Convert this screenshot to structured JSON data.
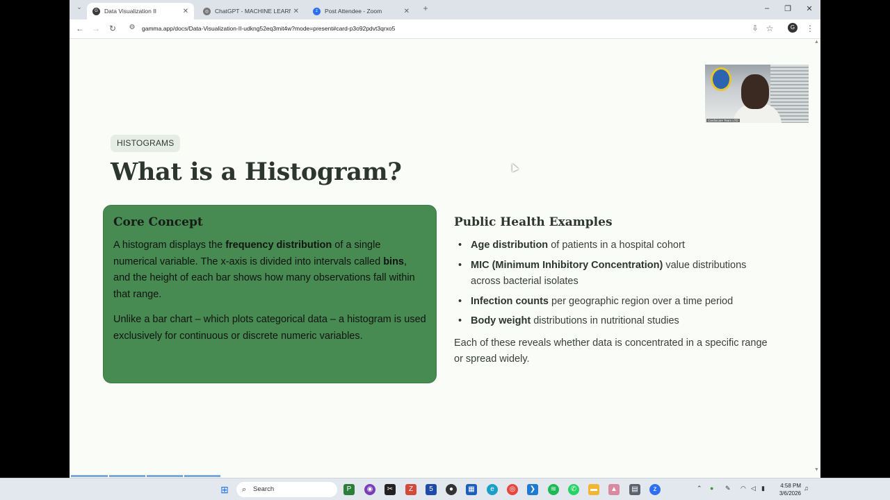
{
  "browser": {
    "tabs": [
      {
        "title": "Data Visualization II",
        "active": true
      },
      {
        "title": "ChatGPT - MACHINE LEARNING",
        "active": false
      },
      {
        "title": "Post Attendee - Zoom",
        "active": false
      }
    ],
    "url": "gamma.app/docs/Data-Visualization-II-udkng52eq3mit4w?mode=present#card-p3o92pdvt3qrxo5"
  },
  "slide": {
    "badge": "HISTOGRAMS",
    "title": "What is a Histogram?",
    "core": {
      "heading": "Core Concept",
      "p1_a": "A histogram displays the ",
      "p1_b": "frequency distribution",
      "p1_c": " of a single numerical variable. The x-axis is divided into intervals called ",
      "p1_d": "bins",
      "p1_e": ", and the height of each bar shows how many observations fall within that range.",
      "p2": "Unlike a bar chart – which plots categorical data – a histogram is used exclusively for continuous or discrete numeric variables."
    },
    "examples": {
      "heading": "Public Health Examples",
      "items": [
        {
          "bold": "Age distribution",
          "rest": " of patients in a hospital cohort"
        },
        {
          "bold": "MIC (Minimum Inhibitory Concentration)",
          "rest": " value distributions across bacterial isolates"
        },
        {
          "bold": "Infection counts",
          "rest": " per geographic region over a time period"
        },
        {
          "bold": "Body weight",
          "rest": " distributions in nutritional studies"
        }
      ],
      "footer": "Each of these reveals whether data is concentrated in a specific range or spread widely."
    },
    "video_caption": "Cardiocare Team LTD"
  },
  "taskbar": {
    "search_placeholder": "Search",
    "time": "4:58 PM",
    "date": "3/6/2026"
  },
  "colors": {
    "card_green": "#478a52",
    "title": "#2d3530",
    "badge_bg": "#e5ede4"
  }
}
